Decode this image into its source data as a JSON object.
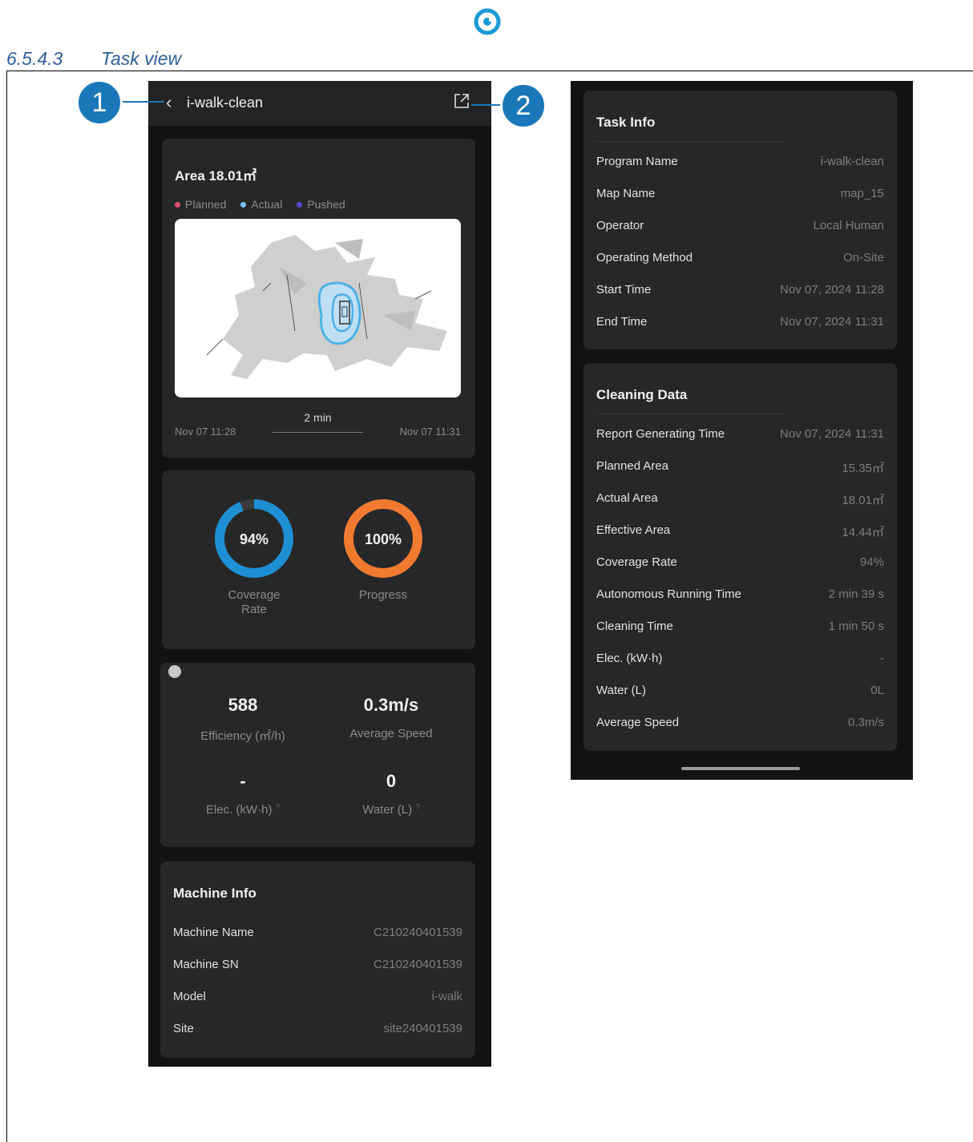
{
  "doc": {
    "section_number": "6.5.4.3",
    "section_title": "Task view",
    "callouts": [
      "1",
      "2"
    ]
  },
  "task": {
    "title": "i-walk-clean",
    "area_label": "Area 18.01㎡",
    "legend": [
      {
        "label": "Planned",
        "color": "#e0506a"
      },
      {
        "label": "Actual",
        "color": "#7cc4ec"
      },
      {
        "label": "Pushed",
        "color": "#5a4bc9"
      }
    ],
    "start_time": "Nov 07 11:28",
    "end_time": "Nov 07 11:31",
    "duration": "2 min"
  },
  "donuts": [
    {
      "value_text": "94%",
      "value": 0.94,
      "label_line1": "Coverage",
      "label_line2": "Rate",
      "color": "#1f8fd4"
    },
    {
      "value_text": "100%",
      "value": 1.0,
      "label_line1": "Progress",
      "label_line2": "",
      "color": "#f07a30"
    }
  ],
  "stats": {
    "efficiency_value": "588",
    "efficiency_label": "Efficiency (㎡/h)",
    "speed_value": "0.3m/s",
    "speed_label": "Average Speed",
    "elec_value": "-",
    "elec_label": "Elec. (kW·h)",
    "water_value": "0",
    "water_label": "Water (L)"
  },
  "machine_info": {
    "title": "Machine Info",
    "rows": [
      {
        "k": "Machine Name",
        "v": "C210240401539"
      },
      {
        "k": "Machine SN",
        "v": "C210240401539"
      },
      {
        "k": "Model",
        "v": "i-walk"
      },
      {
        "k": "Site",
        "v": "site240401539"
      }
    ]
  },
  "task_info": {
    "title": "Task Info",
    "rows": [
      {
        "k": "Program Name",
        "v": "i-walk-clean"
      },
      {
        "k": "Map Name",
        "v": "map_15"
      },
      {
        "k": "Operator",
        "v": "Local Human"
      },
      {
        "k": "Operating Method",
        "v": "On-Site"
      },
      {
        "k": "Start Time",
        "v": "Nov 07, 2024 11:28"
      },
      {
        "k": "End Time",
        "v": "Nov 07, 2024 11:31"
      }
    ]
  },
  "cleaning_data": {
    "title": "Cleaning Data",
    "rows": [
      {
        "k": "Report Generating Time",
        "v": "Nov 07, 2024 11:31"
      },
      {
        "k": "Planned Area",
        "v": "15.35㎡"
      },
      {
        "k": "Actual Area",
        "v": "18.01㎡"
      },
      {
        "k": "Effective Area",
        "v": "14.44㎡"
      },
      {
        "k": "Coverage Rate",
        "v": "94%"
      },
      {
        "k": "Autonomous Running Time",
        "v": "2 min 39 s"
      },
      {
        "k": "Cleaning Time",
        "v": "1 min 50 s"
      },
      {
        "k": "Elec. (kW·h)",
        "v": "-"
      },
      {
        "k": "Water (L)",
        "v": "0L"
      },
      {
        "k": "Average Speed",
        "v": "0.3m/s"
      }
    ]
  }
}
